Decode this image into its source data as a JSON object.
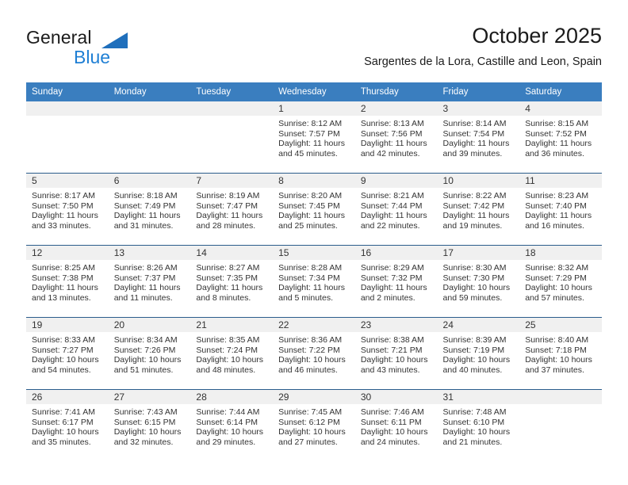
{
  "brand": {
    "name_dark": "General",
    "name_blue": "Blue",
    "triangle_color": "#1f6fbc",
    "blue_color": "#1f7fd4"
  },
  "header": {
    "title": "October 2025",
    "subtitle": "Sargentes de la Lora, Castille and Leon, Spain"
  },
  "theme": {
    "header_bg": "#3a7ebf",
    "header_text": "#ffffff",
    "week_divider": "#2b5d8c",
    "daynum_bg": "#f0f0f0",
    "body_text": "#333333"
  },
  "calendar": {
    "weekday_headers": [
      "Sunday",
      "Monday",
      "Tuesday",
      "Wednesday",
      "Thursday",
      "Friday",
      "Saturday"
    ],
    "weeks": [
      [
        {
          "day": "",
          "empty": true
        },
        {
          "day": "",
          "empty": true
        },
        {
          "day": "",
          "empty": true
        },
        {
          "day": "1",
          "sunrise": "Sunrise: 8:12 AM",
          "sunset": "Sunset: 7:57 PM",
          "daylight": "Daylight: 11 hours and 45 minutes."
        },
        {
          "day": "2",
          "sunrise": "Sunrise: 8:13 AM",
          "sunset": "Sunset: 7:56 PM",
          "daylight": "Daylight: 11 hours and 42 minutes."
        },
        {
          "day": "3",
          "sunrise": "Sunrise: 8:14 AM",
          "sunset": "Sunset: 7:54 PM",
          "daylight": "Daylight: 11 hours and 39 minutes."
        },
        {
          "day": "4",
          "sunrise": "Sunrise: 8:15 AM",
          "sunset": "Sunset: 7:52 PM",
          "daylight": "Daylight: 11 hours and 36 minutes."
        }
      ],
      [
        {
          "day": "5",
          "sunrise": "Sunrise: 8:17 AM",
          "sunset": "Sunset: 7:50 PM",
          "daylight": "Daylight: 11 hours and 33 minutes."
        },
        {
          "day": "6",
          "sunrise": "Sunrise: 8:18 AM",
          "sunset": "Sunset: 7:49 PM",
          "daylight": "Daylight: 11 hours and 31 minutes."
        },
        {
          "day": "7",
          "sunrise": "Sunrise: 8:19 AM",
          "sunset": "Sunset: 7:47 PM",
          "daylight": "Daylight: 11 hours and 28 minutes."
        },
        {
          "day": "8",
          "sunrise": "Sunrise: 8:20 AM",
          "sunset": "Sunset: 7:45 PM",
          "daylight": "Daylight: 11 hours and 25 minutes."
        },
        {
          "day": "9",
          "sunrise": "Sunrise: 8:21 AM",
          "sunset": "Sunset: 7:44 PM",
          "daylight": "Daylight: 11 hours and 22 minutes."
        },
        {
          "day": "10",
          "sunrise": "Sunrise: 8:22 AM",
          "sunset": "Sunset: 7:42 PM",
          "daylight": "Daylight: 11 hours and 19 minutes."
        },
        {
          "day": "11",
          "sunrise": "Sunrise: 8:23 AM",
          "sunset": "Sunset: 7:40 PM",
          "daylight": "Daylight: 11 hours and 16 minutes."
        }
      ],
      [
        {
          "day": "12",
          "sunrise": "Sunrise: 8:25 AM",
          "sunset": "Sunset: 7:38 PM",
          "daylight": "Daylight: 11 hours and 13 minutes."
        },
        {
          "day": "13",
          "sunrise": "Sunrise: 8:26 AM",
          "sunset": "Sunset: 7:37 PM",
          "daylight": "Daylight: 11 hours and 11 minutes."
        },
        {
          "day": "14",
          "sunrise": "Sunrise: 8:27 AM",
          "sunset": "Sunset: 7:35 PM",
          "daylight": "Daylight: 11 hours and 8 minutes."
        },
        {
          "day": "15",
          "sunrise": "Sunrise: 8:28 AM",
          "sunset": "Sunset: 7:34 PM",
          "daylight": "Daylight: 11 hours and 5 minutes."
        },
        {
          "day": "16",
          "sunrise": "Sunrise: 8:29 AM",
          "sunset": "Sunset: 7:32 PM",
          "daylight": "Daylight: 11 hours and 2 minutes."
        },
        {
          "day": "17",
          "sunrise": "Sunrise: 8:30 AM",
          "sunset": "Sunset: 7:30 PM",
          "daylight": "Daylight: 10 hours and 59 minutes."
        },
        {
          "day": "18",
          "sunrise": "Sunrise: 8:32 AM",
          "sunset": "Sunset: 7:29 PM",
          "daylight": "Daylight: 10 hours and 57 minutes."
        }
      ],
      [
        {
          "day": "19",
          "sunrise": "Sunrise: 8:33 AM",
          "sunset": "Sunset: 7:27 PM",
          "daylight": "Daylight: 10 hours and 54 minutes."
        },
        {
          "day": "20",
          "sunrise": "Sunrise: 8:34 AM",
          "sunset": "Sunset: 7:26 PM",
          "daylight": "Daylight: 10 hours and 51 minutes."
        },
        {
          "day": "21",
          "sunrise": "Sunrise: 8:35 AM",
          "sunset": "Sunset: 7:24 PM",
          "daylight": "Daylight: 10 hours and 48 minutes."
        },
        {
          "day": "22",
          "sunrise": "Sunrise: 8:36 AM",
          "sunset": "Sunset: 7:22 PM",
          "daylight": "Daylight: 10 hours and 46 minutes."
        },
        {
          "day": "23",
          "sunrise": "Sunrise: 8:38 AM",
          "sunset": "Sunset: 7:21 PM",
          "daylight": "Daylight: 10 hours and 43 minutes."
        },
        {
          "day": "24",
          "sunrise": "Sunrise: 8:39 AM",
          "sunset": "Sunset: 7:19 PM",
          "daylight": "Daylight: 10 hours and 40 minutes."
        },
        {
          "day": "25",
          "sunrise": "Sunrise: 8:40 AM",
          "sunset": "Sunset: 7:18 PM",
          "daylight": "Daylight: 10 hours and 37 minutes."
        }
      ],
      [
        {
          "day": "26",
          "sunrise": "Sunrise: 7:41 AM",
          "sunset": "Sunset: 6:17 PM",
          "daylight": "Daylight: 10 hours and 35 minutes."
        },
        {
          "day": "27",
          "sunrise": "Sunrise: 7:43 AM",
          "sunset": "Sunset: 6:15 PM",
          "daylight": "Daylight: 10 hours and 32 minutes."
        },
        {
          "day": "28",
          "sunrise": "Sunrise: 7:44 AM",
          "sunset": "Sunset: 6:14 PM",
          "daylight": "Daylight: 10 hours and 29 minutes."
        },
        {
          "day": "29",
          "sunrise": "Sunrise: 7:45 AM",
          "sunset": "Sunset: 6:12 PM",
          "daylight": "Daylight: 10 hours and 27 minutes."
        },
        {
          "day": "30",
          "sunrise": "Sunrise: 7:46 AM",
          "sunset": "Sunset: 6:11 PM",
          "daylight": "Daylight: 10 hours and 24 minutes."
        },
        {
          "day": "31",
          "sunrise": "Sunrise: 7:48 AM",
          "sunset": "Sunset: 6:10 PM",
          "daylight": "Daylight: 10 hours and 21 minutes."
        },
        {
          "day": "",
          "empty": true
        }
      ]
    ]
  }
}
